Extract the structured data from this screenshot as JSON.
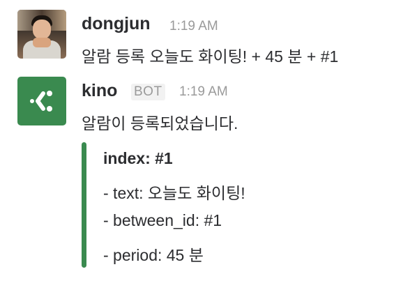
{
  "messages": [
    {
      "username": "dongjun",
      "timestamp": "1:19 AM",
      "text": "알람 등록 오늘도 화이팅! + 45 분 + #1",
      "avatar": "user-photo"
    },
    {
      "username": "kino",
      "badge": "BOT",
      "timestamp": "1:19 AM",
      "text": "알람이 등록되었습니다.",
      "avatar": "kino-bot-logo",
      "attachment": {
        "color": "#3a8a4f",
        "title": "index: #1",
        "fields": [
          "- text: 오늘도 화이팅!",
          "- between_id: #1",
          "- period: 45 분"
        ]
      }
    }
  ]
}
